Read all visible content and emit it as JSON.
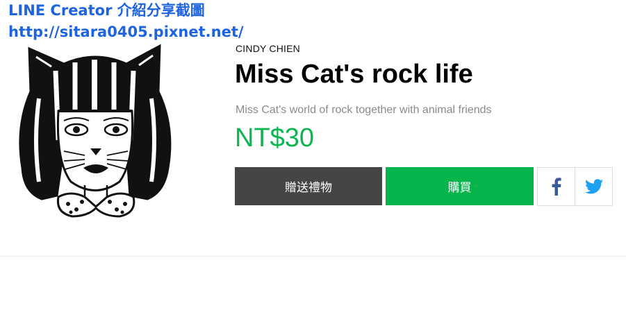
{
  "watermark": {
    "line1": "LINE Creator 介紹分享截圖",
    "line2": "http://sitara0405.pixnet.net/"
  },
  "product": {
    "author": "CINDY CHIEN",
    "title": "Miss Cat's rock life",
    "description": "Miss Cat's world of rock together with animal friends",
    "price": "NT$30",
    "image_icon": "cat-girl-sticker"
  },
  "actions": {
    "gift_label": "贈送禮物",
    "buy_label": "購買",
    "gift_color": "#454545",
    "buy_color": "#06b64c"
  },
  "share": {
    "facebook_icon": "facebook-icon",
    "twitter_icon": "twitter-icon",
    "facebook_color": "#3b5998",
    "twitter_color": "#1da1f2"
  }
}
